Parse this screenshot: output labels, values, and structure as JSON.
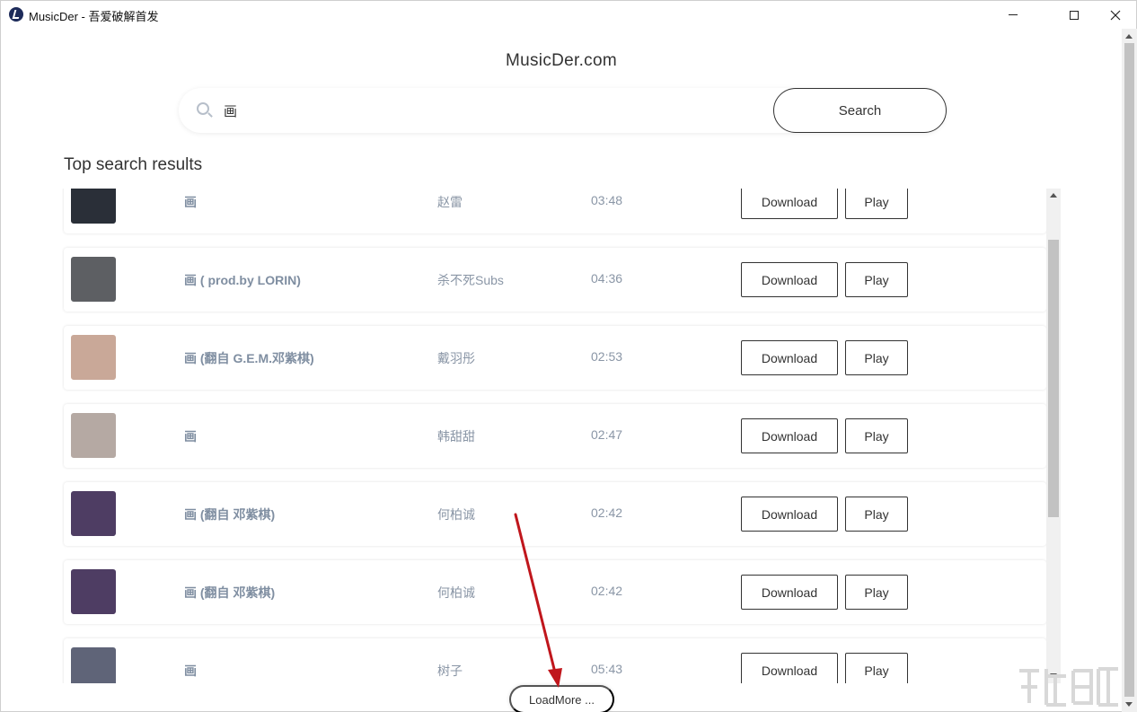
{
  "window": {
    "title": "MusicDer - 吾爱破解首发"
  },
  "header": {
    "brand": "MusicDer.com"
  },
  "search": {
    "value": "画",
    "button_label": "Search"
  },
  "results": {
    "title": "Top search results",
    "download_label": "Download",
    "play_label": "Play",
    "rows": [
      {
        "song": "画",
        "artist": "赵雷",
        "duration": "03:48",
        "thumb_color": "#2a2f38"
      },
      {
        "song": "画 ( prod.by LORIN)",
        "artist": "杀不死Subs",
        "duration": "04:36",
        "thumb_color": "#5d5f63"
      },
      {
        "song": "画 (翻自 G.E.M.邓紫棋)",
        "artist": "戴羽彤",
        "duration": "02:53",
        "thumb_color": "#c9a898"
      },
      {
        "song": "画",
        "artist": "韩甜甜",
        "duration": "02:47",
        "thumb_color": "#b5a9a3"
      },
      {
        "song": "画 (翻自 邓紫棋)",
        "artist": "何柏诚",
        "duration": "02:42",
        "thumb_color": "#4e3d63"
      },
      {
        "song": "画 (翻自 邓紫棋)",
        "artist": "何柏诚",
        "duration": "02:42",
        "thumb_color": "#4e3d63"
      },
      {
        "song": "画",
        "artist": "树子",
        "duration": "05:43",
        "thumb_color": "#5f6478"
      }
    ]
  },
  "load_more": {
    "label": "LoadMore ..."
  },
  "colors": {
    "annotation_arrow": "#c0161c",
    "song_text": "#7f8ea1",
    "muted_text": "#8a96a6"
  }
}
